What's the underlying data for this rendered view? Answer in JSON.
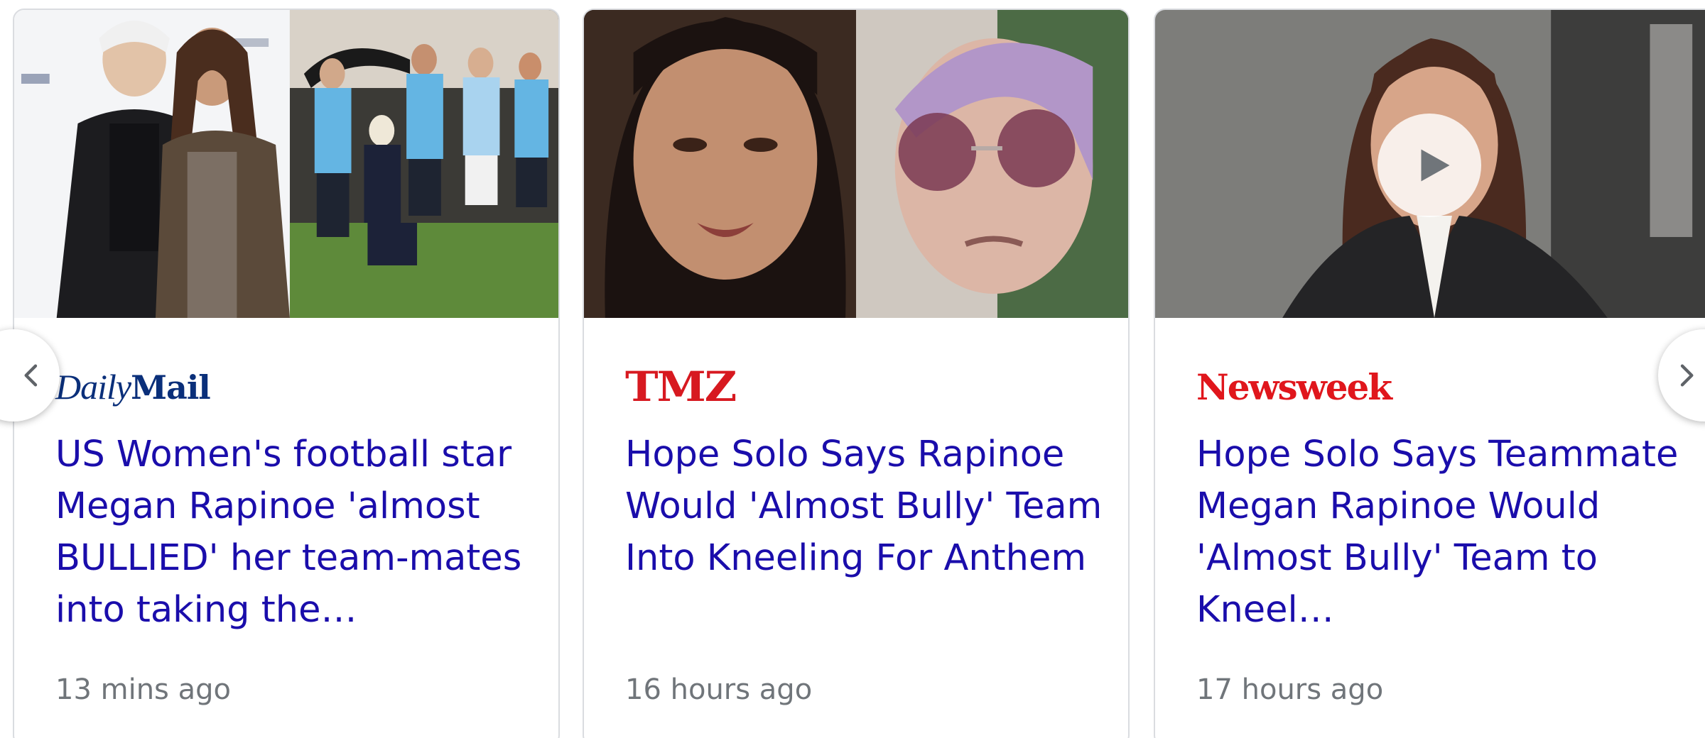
{
  "cards": [
    {
      "source": {
        "part1": "Daily",
        "part2": "Mail"
      },
      "headline": "US Women's football star Megan Rapinoe 'almost BULLIED' her team-mates into taking the…",
      "time": "13 mins ago"
    },
    {
      "source": {
        "name": "TMZ"
      },
      "headline": "Hope Solo Says Rapinoe Would 'Almost Bully' Team Into Kneeling For Anthem",
      "time": "16 hours ago"
    },
    {
      "source": {
        "name": "Newsweek"
      },
      "headline": "Hope Solo Says Teammate Megan Rapinoe Would 'Almost Bully' Team to Kneel…",
      "time": "17 hours ago"
    }
  ],
  "icons": {
    "previous": "chevron-left-icon",
    "next": "chevron-right-icon",
    "play": "play-icon"
  },
  "colors": {
    "headline": "#1a0dab",
    "time": "#70757a",
    "dailymail": "#0a2f7a",
    "tmz": "#d71920",
    "newsweek": "#e0161c",
    "card_border": "#dadce0"
  }
}
